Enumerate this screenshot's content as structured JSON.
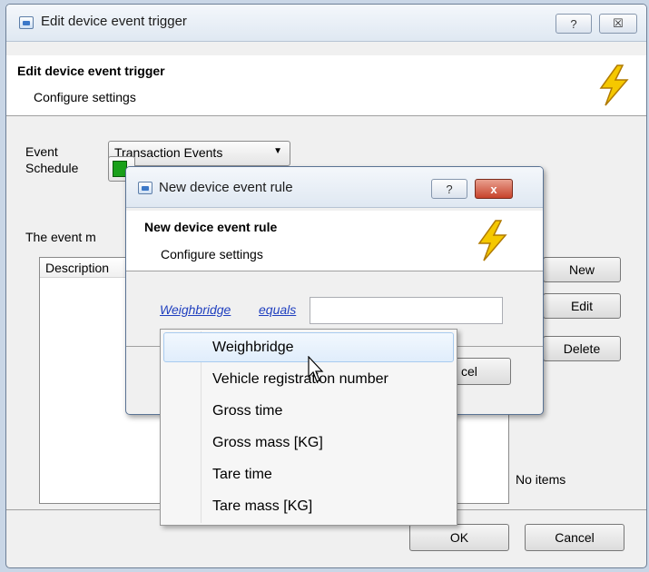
{
  "outer": {
    "title": "Edit device event trigger",
    "header_title": "Edit device event trigger",
    "header_subtitle": "Configure settings",
    "event_label": "Event",
    "event_value": "Transaction Events",
    "schedule_label": "Schedule",
    "event_map_label": "The event m",
    "list_column": "Description",
    "list_empty": "No items",
    "new_button": "New",
    "edit_button": "Edit",
    "delete_button": "Delete",
    "ok_button": "OK",
    "cancel_button": "Cancel",
    "help_glyph": "?",
    "close_glyph": "☒"
  },
  "inner": {
    "title": "New device event rule",
    "header_title": "New device event rule",
    "header_subtitle": "Configure settings",
    "rule_field": "Weighbridge",
    "rule_operator": "equals",
    "rule_value": "",
    "cancel_partial": "cel",
    "help_glyph": "?",
    "close_glyph": "x"
  },
  "dropdown": {
    "options": [
      "Weighbridge",
      "Vehicle registration number",
      "Gross time",
      "Gross mass [KG]",
      "Tare time",
      "Tare mass [KG]"
    ],
    "highlighted_index": 0
  },
  "colors": {
    "bolt": "#f5c800",
    "schedule_swatch": "#1aa01a",
    "link": "#1f3fbf"
  }
}
